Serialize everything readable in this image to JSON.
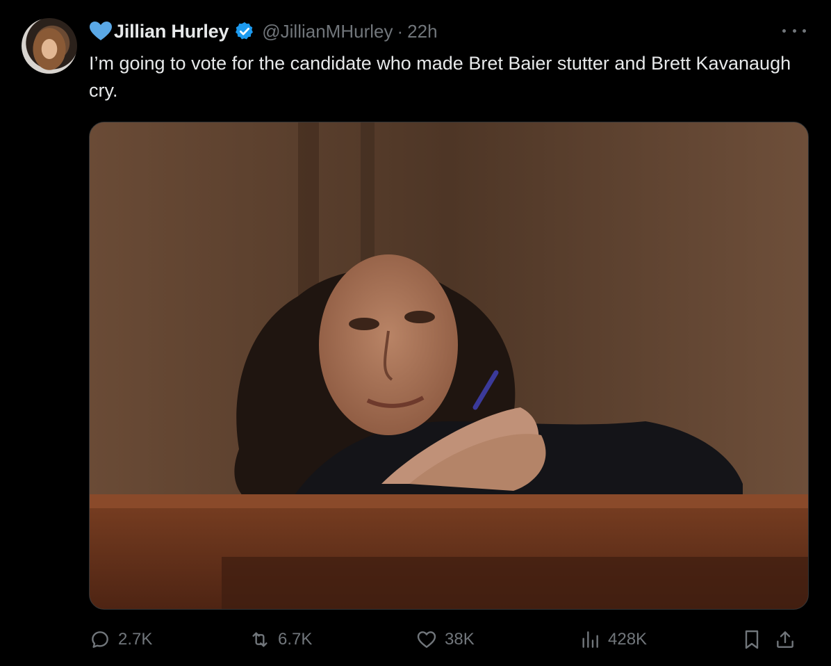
{
  "author": {
    "display_name": "Jillian Hurley",
    "handle": "@JillianMHurley",
    "separator": "·",
    "time": "22h",
    "heart_icon": "blue-heart-icon",
    "verified_icon": "verified-badge-icon",
    "verified_color": "#1d9bf0"
  },
  "tweet": {
    "text": "I’m going to vote for the candidate who made Bret Baier stutter and Brett Kavanaugh cry."
  },
  "media": {
    "type": "photo"
  },
  "actions": {
    "reply_count": "2.7K",
    "repost_count": "6.7K",
    "like_count": "38K",
    "view_count": "428K",
    "icons": [
      "reply-icon",
      "repost-icon",
      "like-icon",
      "views-icon",
      "bookmark-icon",
      "share-icon"
    ]
  },
  "colors": {
    "background": "#000000",
    "text": "#e7e9ea",
    "muted": "#71767b",
    "accent": "#1d9bf0"
  }
}
